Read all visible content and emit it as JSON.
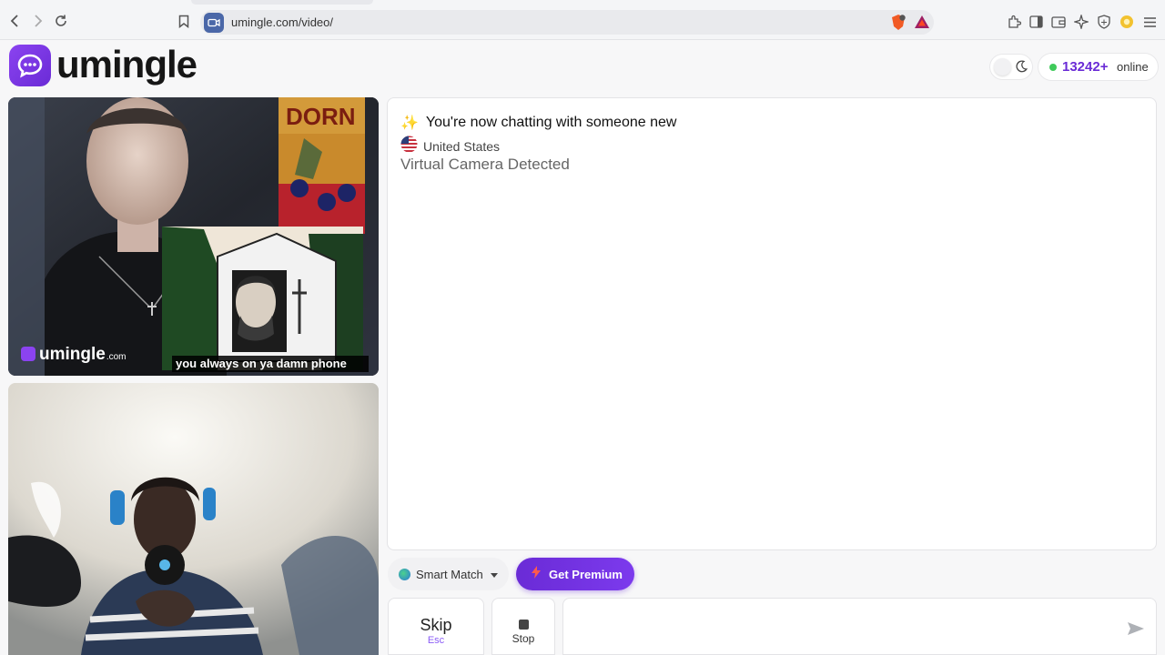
{
  "browser": {
    "url": "umingle.com/video/",
    "icons": [
      "back-icon",
      "forward-icon",
      "reload-icon",
      "bookmark-icon",
      "brave-shield-icon",
      "bat-rewards-icon",
      "extensions-icon",
      "sidebar-icon",
      "wallet-icon",
      "leo-ai-icon",
      "vpn-icon",
      "profile-icon",
      "menu-icon"
    ]
  },
  "header": {
    "logo_text": "umingle",
    "online_count": "13242+",
    "online_label": "online",
    "accent_color": "#6a2bd6",
    "online_dot_color": "#3fca5a"
  },
  "remote_video": {
    "watermark_text": "umingle",
    "watermark_suffix": ".com",
    "caption": "you always on ya damn phone"
  },
  "chat": {
    "new_chat_emoji": "✨",
    "new_chat_text": "You're now chatting with someone new",
    "country": "United States",
    "warning": "Virtual Camera Detected"
  },
  "controls": {
    "match_mode": "Smart Match",
    "premium_label": "Get Premium",
    "skip_label": "Skip",
    "skip_shortcut": "Esc",
    "stop_label": "Stop",
    "message_placeholder": ""
  }
}
